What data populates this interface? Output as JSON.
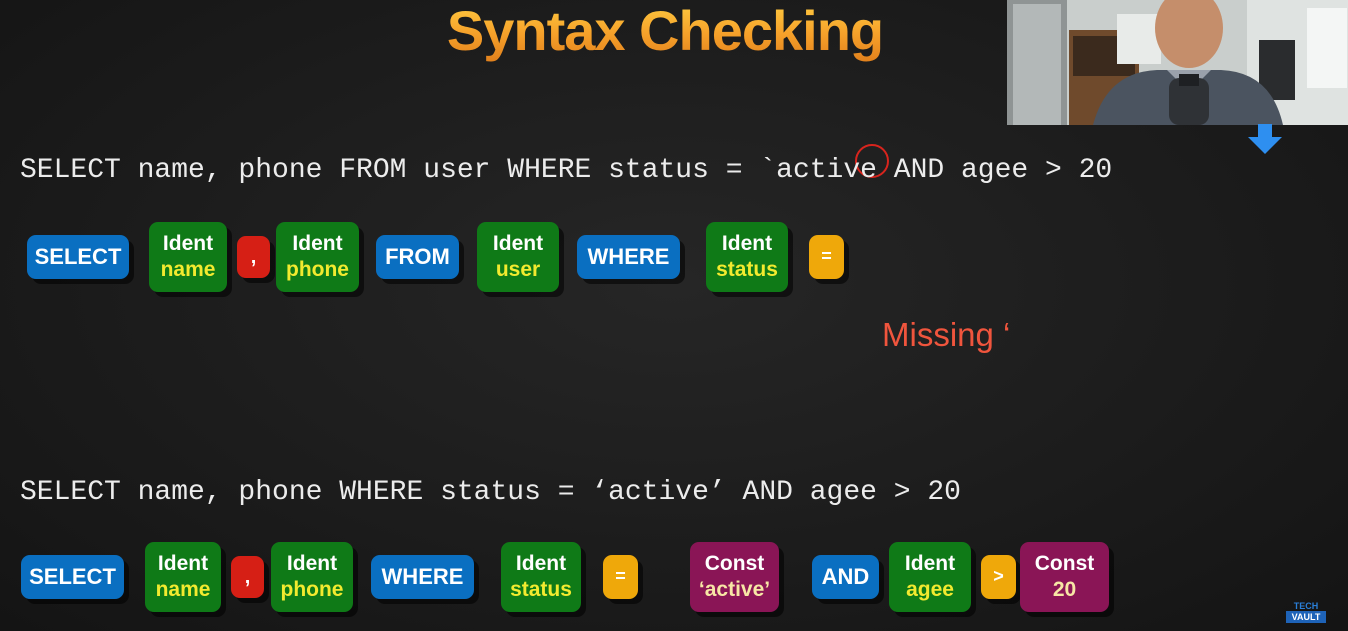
{
  "title": "Syntax Checking",
  "example1": {
    "sql_before_quote": "SELECT name, phone FROM user WHERE status = ",
    "quote": "`",
    "sql_after_quote": "active AND agee > 20",
    "tokens": {
      "select": "SELECT",
      "ident_name": {
        "type": "Ident",
        "value": "name"
      },
      "comma": ",",
      "ident_phone": {
        "type": "Ident",
        "value": "phone"
      },
      "from": "FROM",
      "ident_user": {
        "type": "Ident",
        "value": "user"
      },
      "where": "WHERE",
      "ident_status": {
        "type": "Ident",
        "value": "status"
      },
      "equals": "="
    },
    "error_message": "Missing ‘"
  },
  "example2": {
    "sql": "SELECT name, phone WHERE status = ‘active’ AND agee > 20",
    "tokens": {
      "select": "SELECT",
      "ident_name": {
        "type": "Ident",
        "value": "name"
      },
      "comma": ",",
      "ident_phone": {
        "type": "Ident",
        "value": "phone"
      },
      "where": "WHERE",
      "ident_status": {
        "type": "Ident",
        "value": "status"
      },
      "equals": "=",
      "const_active": {
        "type": "Const",
        "value": "‘active’"
      },
      "and": "AND",
      "ident_agee": {
        "type": "Ident",
        "value": "agee"
      },
      "greater": ">",
      "const_20": {
        "type": "Const",
        "value": "20"
      }
    }
  },
  "logo": {
    "line1": "TECH",
    "line2": "VAULT"
  },
  "colors": {
    "title_gradient_top": "#ffcf43",
    "title_gradient_bottom": "#e07f1c",
    "keyword": "#0a6fc1",
    "ident": "#0f7a17",
    "ident_value": "#f2ea2f",
    "const": "#8a1556",
    "punctuation": "#d61f15",
    "operator": "#efa80a",
    "error_text": "#f0553d",
    "arrow": "#2e8ff0"
  },
  "icons": {
    "cursor_marker": "down-arrow-icon",
    "error_marker": "circle-highlight"
  }
}
